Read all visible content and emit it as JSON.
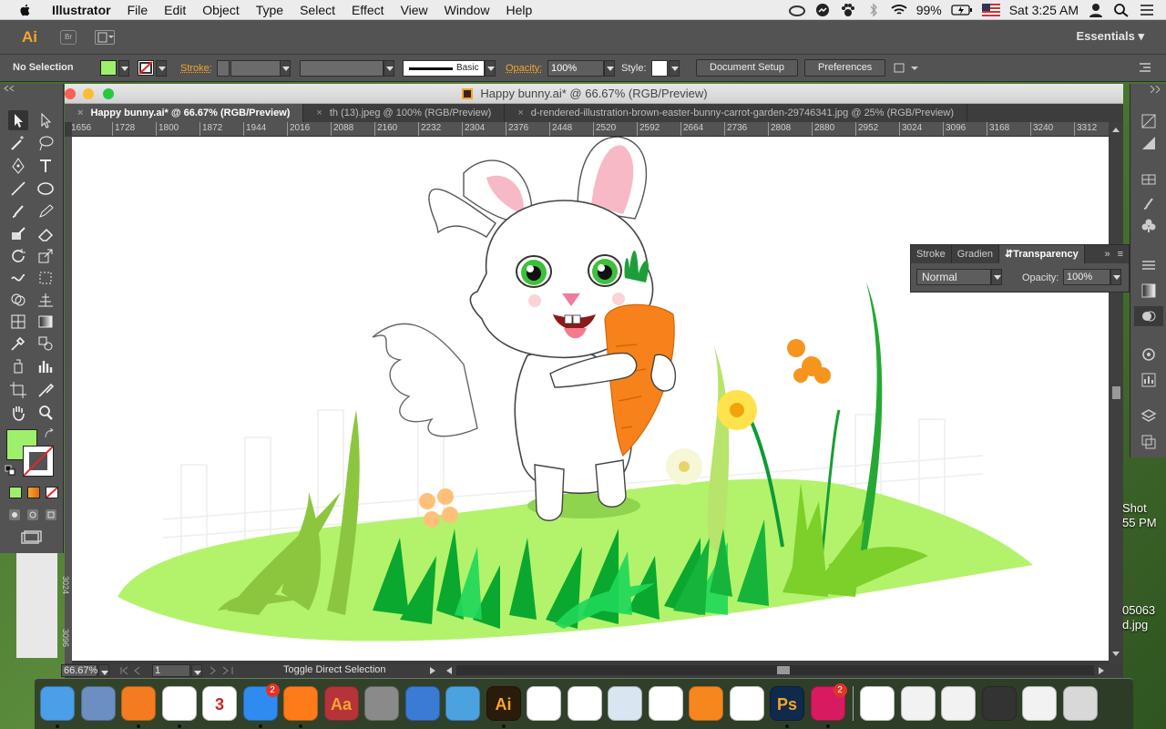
{
  "menubar": {
    "app": "Illustrator",
    "items": [
      "File",
      "Edit",
      "Object",
      "Type",
      "Select",
      "Effect",
      "View",
      "Window",
      "Help"
    ],
    "battery": "99%",
    "clock": "Sat 3:25 AM"
  },
  "appbar": {
    "logo": "Ai",
    "bridge": "Br",
    "workspace": "Essentials"
  },
  "control": {
    "selection": "No Selection",
    "fill_color": "#9ef06c",
    "stroke_label": "Stroke:",
    "brush": "Basic",
    "opacity_label": "Opacity:",
    "opacity_value": "100%",
    "style_label": "Style:",
    "document_setup": "Document Setup",
    "preferences": "Preferences"
  },
  "document": {
    "title": "Happy bunny.ai* @ 66.67% (RGB/Preview)",
    "tabs": [
      {
        "label": "Happy bunny.ai* @ 66.67% (RGB/Preview)",
        "active": true
      },
      {
        "label": "th (13).jpeg @ 100% (RGB/Preview)",
        "active": false
      },
      {
        "label": "d-rendered-illustration-brown-easter-bunny-carrot-garden-29746341.jpg @ 25% (RGB/Preview)",
        "active": false
      }
    ],
    "ruler_ticks": [
      "1656",
      "1728",
      "1800",
      "1872",
      "1944",
      "2016",
      "2088",
      "2160",
      "2232",
      "2304",
      "2376",
      "2448",
      "2520",
      "2592",
      "2664",
      "2736",
      "2808",
      "2880",
      "2952",
      "3024",
      "3096",
      "3168",
      "3240",
      "3312"
    ],
    "vruler_labels": [
      "3024",
      "3096"
    ],
    "zoom": "66.67%",
    "artboard": "1",
    "status": "Toggle Direct Selection"
  },
  "transparency_panel": {
    "tabs": [
      "Stroke",
      "Gradien",
      "Transparency"
    ],
    "blend_mode": "Normal",
    "opacity_label": "Opacity:",
    "opacity_value": "100%"
  },
  "desktop": {
    "labels": [
      "Shot",
      "55 PM",
      "05063",
      "d.jpg"
    ]
  },
  "dock": {
    "apps": [
      {
        "name": "Finder",
        "color": "#4a9fe8"
      },
      {
        "name": "Preview",
        "color": "#6a8fc0"
      },
      {
        "name": "N",
        "color": "#f47b20"
      },
      {
        "name": "Chrome",
        "color": "#ffffff"
      },
      {
        "name": "Calendar",
        "color": "#ffffff",
        "text": "3"
      },
      {
        "name": "App Store",
        "color": "#2f8bf0",
        "badge": "2"
      },
      {
        "name": "Firefox",
        "color": "#ff7b1a"
      },
      {
        "name": "Dictionary",
        "color": "#b4343a",
        "text": "Aa"
      },
      {
        "name": "System Preferences",
        "color": "#8a8a8a"
      },
      {
        "name": "W",
        "color": "#3a7bd5"
      },
      {
        "name": "Mail",
        "color": "#4aa3df"
      },
      {
        "name": "Illustrator",
        "color": "#2b1b0a",
        "text": "Ai"
      },
      {
        "name": "X",
        "color": "#ffffff"
      },
      {
        "name": "P",
        "color": "#ffffff"
      },
      {
        "name": "Image Capture",
        "color": "#d9e6f2"
      },
      {
        "name": "Photos",
        "color": "#ffffff"
      },
      {
        "name": "iBooks",
        "color": "#f6871f"
      },
      {
        "name": "Acrobat",
        "color": "#ffffff"
      },
      {
        "name": "Photoshop",
        "color": "#0f2a4a",
        "text": "Ps"
      },
      {
        "name": "W2",
        "color": "#d81b60",
        "badge": "2"
      },
      {
        "name": "Document",
        "color": "#ffffff"
      },
      {
        "name": "File1",
        "color": "#f2f2f2"
      },
      {
        "name": "File2",
        "color": "#f2f2f2"
      },
      {
        "name": "Screen",
        "color": "#333333"
      },
      {
        "name": "File3",
        "color": "#f2f2f2"
      },
      {
        "name": "Trash",
        "color": "#d8d8d8"
      }
    ]
  }
}
